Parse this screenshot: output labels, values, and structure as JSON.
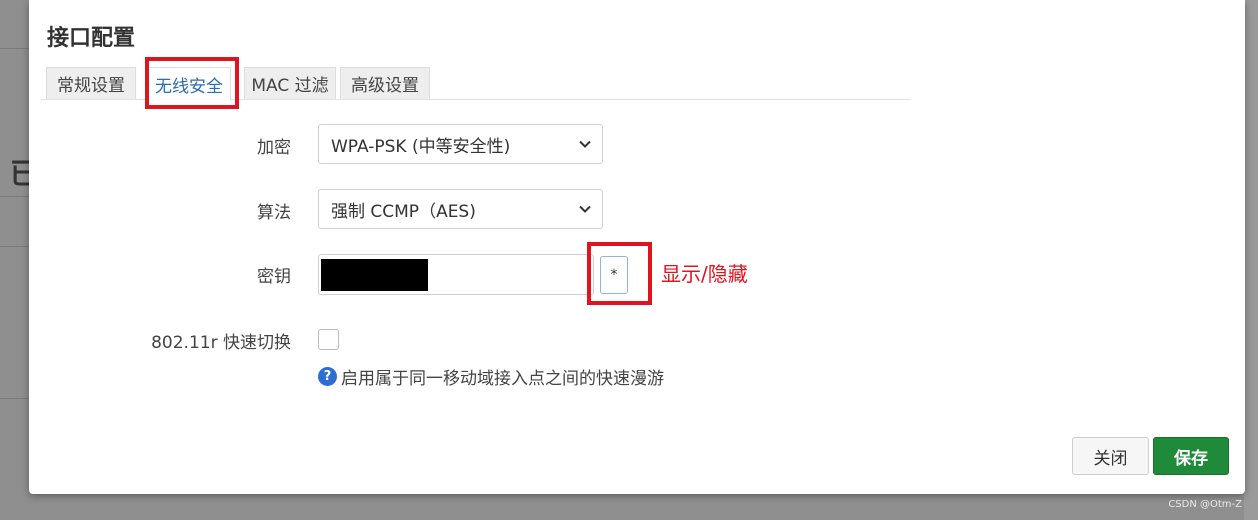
{
  "modal": {
    "title": "接口配置"
  },
  "tabs": [
    {
      "label": "常规设置",
      "active": false
    },
    {
      "label": "无线安全",
      "active": true
    },
    {
      "label": "MAC 过滤",
      "active": false
    },
    {
      "label": "高级设置",
      "active": false
    }
  ],
  "form": {
    "encryption": {
      "label": "加密",
      "value": "WPA-PSK (中等安全性)"
    },
    "cipher": {
      "label": "算法",
      "value": "强制 CCMP（AES)"
    },
    "key": {
      "label": "密钥",
      "reveal_button": "*"
    },
    "fast_transition": {
      "label": "802.11r 快速切换",
      "checked": false,
      "help_icon": "?",
      "help_text": "启用属于同一移动域接入点之间的快速漫游"
    }
  },
  "annotation": {
    "text": "显示/隐藏"
  },
  "buttons": {
    "close": "关闭",
    "save": "保存"
  },
  "background": {
    "partial_heading_char": "已"
  },
  "watermark": "CSDN @Otm-Z",
  "colors": {
    "accent_red": "#e0141e",
    "save_green": "#1f8a3a",
    "tab_active_text": "#2b6cb0"
  },
  "icons": {
    "select_arrow": "chevron-down-icon",
    "help": "question-circle-icon"
  }
}
